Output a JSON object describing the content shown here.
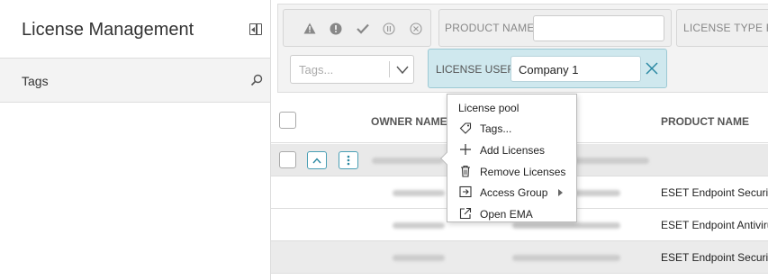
{
  "sidebar": {
    "title": "License Management",
    "tags_label": "Tags"
  },
  "filters": {
    "status_icons": [
      "warning-icon",
      "error-icon",
      "check-icon",
      "pause-icon",
      "cancel-icon"
    ],
    "product_name_label": "PRODUCT NAME",
    "product_name_value": "",
    "license_type_label": "LICENSE TYPE FLA",
    "tags_placeholder": "Tags...",
    "license_user_label": "LICENSE USER",
    "license_user_value": "Company 1"
  },
  "table": {
    "headers": {
      "owner_name": "OWNER NAME",
      "product_name": "PRODUCT NAME"
    },
    "rows": [
      {
        "product": ""
      },
      {
        "product": "ESET Endpoint Security"
      },
      {
        "product": "ESET Endpoint Antivirus"
      },
      {
        "product": "ESET Endpoint Security"
      }
    ]
  },
  "context_menu": {
    "title": "License pool",
    "items": [
      {
        "label": "Tags...",
        "icon": "tag-icon"
      },
      {
        "label": "Add Licenses",
        "icon": "plus-icon"
      },
      {
        "label": "Remove Licenses",
        "icon": "trash-icon"
      },
      {
        "label": "Access Group",
        "icon": "access-group-icon",
        "submenu": true
      },
      {
        "label": "Open EMA",
        "icon": "external-link-icon"
      }
    ]
  },
  "colors": {
    "accent": "#2a88a2",
    "active_filter_bg": "#cfe8ee"
  }
}
